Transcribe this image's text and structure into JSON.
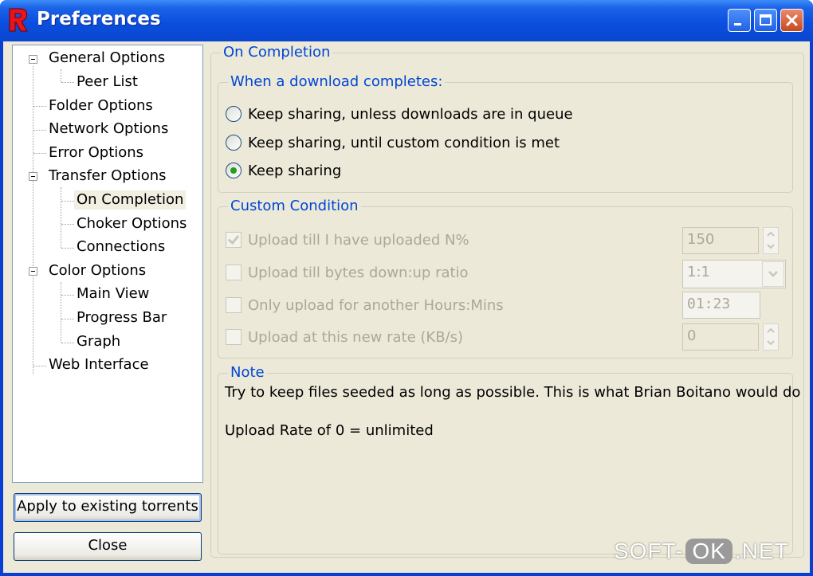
{
  "window": {
    "title": "Preferences",
    "colors": {
      "titlebar": "#0a4fde",
      "client": "#ece9d8",
      "close": "#c8481e",
      "legend": "#0046d5"
    }
  },
  "tree": {
    "items": [
      {
        "label": "General Options",
        "level": 0,
        "expanded": true
      },
      {
        "label": "Peer List",
        "level": 1
      },
      {
        "label": "Folder Options",
        "level": 0
      },
      {
        "label": "Network Options",
        "level": 0
      },
      {
        "label": "Error Options",
        "level": 0
      },
      {
        "label": "Transfer Options",
        "level": 0,
        "expanded": true
      },
      {
        "label": "On Completion",
        "level": 1,
        "selected": true
      },
      {
        "label": "Choker Options",
        "level": 1
      },
      {
        "label": "Connections",
        "level": 1
      },
      {
        "label": "Color Options",
        "level": 0,
        "expanded": true
      },
      {
        "label": "Main View",
        "level": 1
      },
      {
        "label": "Progress Bar",
        "level": 1
      },
      {
        "label": "Graph",
        "level": 1
      },
      {
        "label": "Web Interface",
        "level": 0
      }
    ]
  },
  "buttons": {
    "apply": "Apply to existing torrents",
    "close": "Close"
  },
  "panel": {
    "title": "On Completion",
    "completes_group": {
      "title": "When a download completes:",
      "options": [
        {
          "label": "Keep sharing, unless downloads are in queue",
          "checked": false
        },
        {
          "label": "Keep sharing, until custom condition is met",
          "checked": false
        },
        {
          "label": "Keep sharing",
          "checked": true
        }
      ]
    },
    "custom_group": {
      "title": "Custom Condition",
      "rows": [
        {
          "label": "Upload till I have uploaded N%",
          "checked": true,
          "value": "150",
          "control": "spin"
        },
        {
          "label": "Upload till bytes down:up ratio",
          "checked": false,
          "value": "1:1",
          "control": "combo"
        },
        {
          "label": "Only upload for another Hours:Mins",
          "checked": false,
          "value": "01:23",
          "control": "text"
        },
        {
          "label": "Upload at this new rate (KB/s)",
          "checked": false,
          "value": "0",
          "control": "spin"
        }
      ]
    },
    "note_group": {
      "title": "Note",
      "line1": "Try to keep files seeded as long as possible. This is what Brian Boitano would do",
      "line2": "Upload Rate of 0 = unlimited"
    }
  },
  "watermark": {
    "left": "SOFT-",
    "ok": "OK",
    "right": ".NET"
  }
}
